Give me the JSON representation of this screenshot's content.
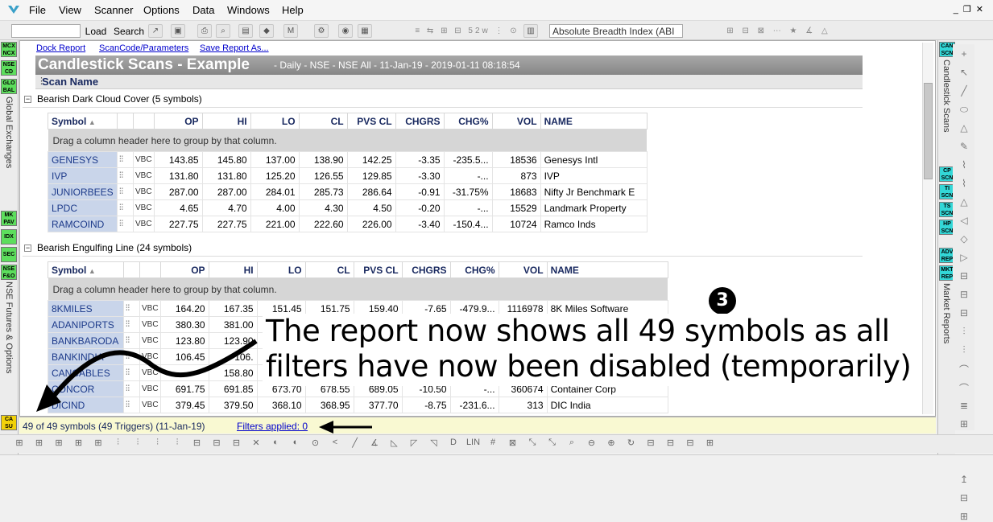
{
  "menu": [
    "File",
    "View",
    "Scanner",
    "Options",
    "Data",
    "Windows",
    "Help"
  ],
  "toolbar": {
    "load_label": "Load",
    "search_label": "Search",
    "breadth_select": "Absolute Breadth Index (ABI"
  },
  "left_sidebar": {
    "labels": [
      "Global Exchanges",
      "NSE Futures & Options"
    ],
    "buttons": [
      "MCX NCX",
      "NSE CD",
      "GLO BAL",
      "MK PAV",
      "IDX",
      "SEC",
      "NSE F&O",
      "CA SU"
    ]
  },
  "links": [
    "Dock Report",
    "ScanCode/Parameters",
    "Save Report As..."
  ],
  "report": {
    "title": "Candlestick Scans - Example",
    "subtitle": "- Daily - NSE - NSE All - 11-Jan-19 - 2019-01-11 08:18:54",
    "scan_name_header": "Scan Name",
    "drag_hint": "Drag a column header here to group by that column."
  },
  "columns": [
    "Symbol",
    "OP",
    "HI",
    "LO",
    "CL",
    "PVS CL",
    "CHGRS",
    "CHG%",
    "VOL",
    "NAME"
  ],
  "groups": [
    {
      "label": "Bearish Dark Cloud Cover (5 symbols)",
      "rows": [
        [
          "GENESYS",
          "143.85",
          "145.80",
          "137.00",
          "138.90",
          "142.25",
          "-3.35",
          "-235.5...",
          "18536",
          "Genesys Intl"
        ],
        [
          "IVP",
          "131.80",
          "131.80",
          "125.20",
          "126.55",
          "129.85",
          "-3.30",
          "-...",
          "873",
          "IVP"
        ],
        [
          "JUNIORBEES",
          "287.00",
          "287.00",
          "284.01",
          "285.73",
          "286.64",
          "-0.91",
          "-31.75%",
          "18683",
          "Nifty Jr Benchmark E"
        ],
        [
          "LPDC",
          "4.65",
          "4.70",
          "4.00",
          "4.30",
          "4.50",
          "-0.20",
          "-...",
          "15529",
          "Landmark Property"
        ],
        [
          "RAMCOIND",
          "227.75",
          "227.75",
          "221.00",
          "222.60",
          "226.00",
          "-3.40",
          "-150.4...",
          "10724",
          "Ramco Inds"
        ]
      ]
    },
    {
      "label": "Bearish Engulfing Line (24 symbols)",
      "rows": [
        [
          "8KMILES",
          "164.20",
          "167.35",
          "151.45",
          "151.75",
          "159.40",
          "-7.65",
          "-479.9...",
          "1116978",
          "8K Miles Software"
        ],
        [
          "ADANIPORTS",
          "380.30",
          "381.00",
          "",
          "",
          "",
          "",
          "",
          "",
          ""
        ],
        [
          "BANKBARODA",
          "123.80",
          "123.90",
          "",
          "",
          "",
          "",
          "",
          "",
          ""
        ],
        [
          "BANKINDIA",
          "106.45",
          "106.",
          "",
          "",
          "",
          "",
          "",
          "",
          ""
        ],
        [
          "CANCABLES",
          "",
          "158.80",
          "",
          "",
          "",
          "",
          "",
          "",
          ""
        ],
        [
          "CONCOR",
          "691.75",
          "691.85",
          "673.70",
          "678.55",
          "689.05",
          "-10.50",
          "-...",
          "360674",
          "Container Corp"
        ],
        [
          "DICIND",
          "379.45",
          "379.50",
          "368.10",
          "368.95",
          "377.70",
          "-8.75",
          "-231.6...",
          "313",
          "DIC India"
        ]
      ]
    }
  ],
  "status": {
    "count_text": "49 of 49 symbols (49 Triggers) (11-Jan-19)",
    "filters_link": "Filters applied: 0"
  },
  "right_strip": {
    "labels": [
      "Candlestick Scans",
      "Market Reports"
    ],
    "buttons": [
      "CAN SCN",
      "CP SCN",
      "TI SCN",
      "TS SCN",
      "HP SCN",
      "ADV REP",
      "MKT REP"
    ]
  },
  "annotation": {
    "step": "3",
    "line1": "The report now shows all 49 symbols as all",
    "line2": "filters have now been disabled (temporarily)"
  },
  "colors": {
    "title_bar": "#8f8f8f",
    "symbol_cell": "#c9d5ea",
    "status_bar": "#f9f9d2",
    "link": "#0000cc"
  }
}
